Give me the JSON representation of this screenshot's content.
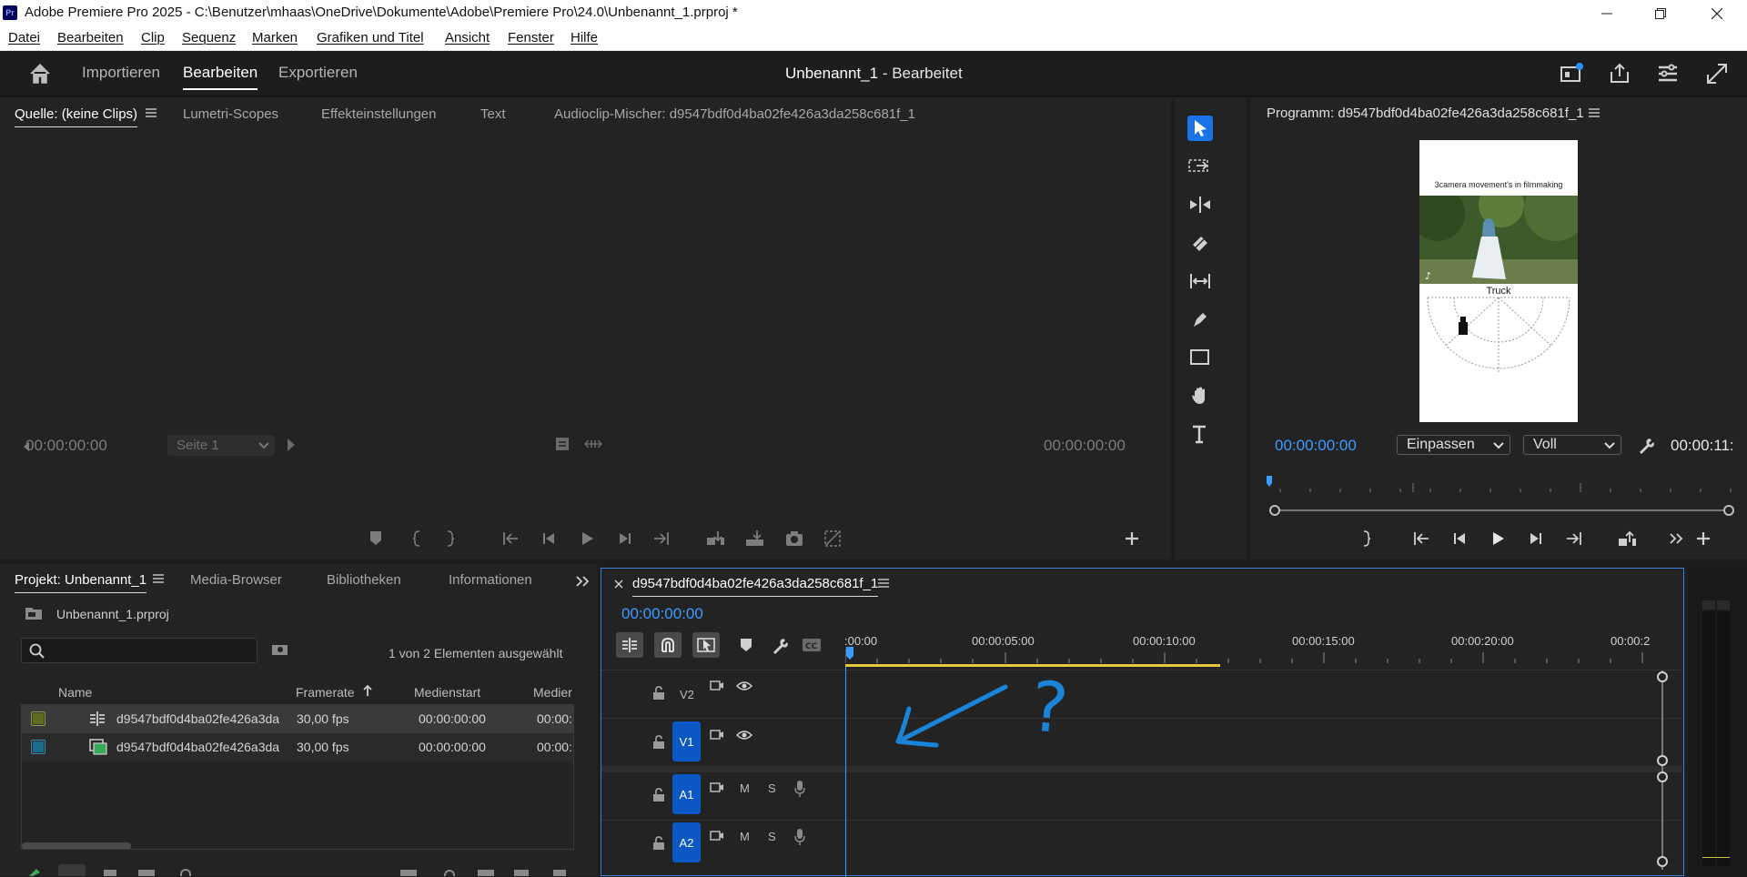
{
  "window": {
    "logo": "Pr",
    "title": "Adobe Premiere Pro 2025 - C:\\Benutzer\\mhaas\\OneDrive\\Dokumente\\Adobe\\Premiere Pro\\24.0\\Unbenannt_1.prproj *",
    "minimize_icon": "minimize-icon",
    "restore_icon": "restore-icon",
    "close_icon": "close-icon"
  },
  "menu": [
    "Datei",
    "Bearbeiten",
    "Clip",
    "Sequenz",
    "Marken",
    "Grafiken und Titel",
    "Ansicht",
    "Fenster",
    "Hilfe"
  ],
  "header": {
    "tabs": [
      "Importieren",
      "Bearbeiten",
      "Exportieren"
    ],
    "active_tab": "Bearbeiten",
    "project_name": "Unbenannt_1",
    "status": " - Bearbeitet"
  },
  "source": {
    "tabs": [
      "Quelle: (keine Clips)",
      "Lumetri-Scopes",
      "Effekteinstellungen",
      "Text",
      "Audioclip-Mischer: d9547bdf0d4ba02fe426a3da258c681f_1"
    ],
    "timecode_left": "00:00:00:00",
    "timecode_right": "00:00:00:00",
    "page_select": "Seite 1"
  },
  "program": {
    "title": "Programm: d9547bdf0d4ba02fe426a3da258c681f_1",
    "timecode": "00:00:00:00",
    "duration": "00:00:11:",
    "fit": "Einpassen",
    "quality": "Voll",
    "frame_caption": "3camera movement's in filmmaking",
    "frame_label": "Truck"
  },
  "project": {
    "tabs": [
      "Projekt: Unbenannt_1",
      "Media-Browser",
      "Bibliotheken",
      "Informationen"
    ],
    "file": "Unbenannt_1.prproj",
    "selection": "1 von 2 Elementen ausgewählt",
    "columns": [
      "Name",
      "Framerate",
      "Medienstart",
      "Medier"
    ],
    "rows": [
      {
        "color": "#5e6b1c",
        "name": "d9547bdf0d4ba02fe426a3da",
        "fps": "30,00 fps",
        "start": "00:00:00:00",
        "end": "00:00:",
        "type": "sequence"
      },
      {
        "color": "#1d6e8a",
        "name": "d9547bdf0d4ba02fe426a3da",
        "fps": "30,00 fps",
        "start": "00:00:00:00",
        "end": "00:00:",
        "type": "clip"
      }
    ]
  },
  "timeline": {
    "sequence": "d9547bdf0d4ba02fe426a3da258c681f_1",
    "timecode": "00:00:00:00",
    "ruler": [
      ":00:00",
      "00:00:05:00",
      "00:00:10:00",
      "00:00:15:00",
      "00:00:20:00",
      "00:00:2"
    ],
    "video_tracks": [
      "V2",
      "V1"
    ],
    "audio_tracks": [
      "A1",
      "A2"
    ],
    "mute": "M",
    "solo": "S",
    "annotation": "?"
  }
}
